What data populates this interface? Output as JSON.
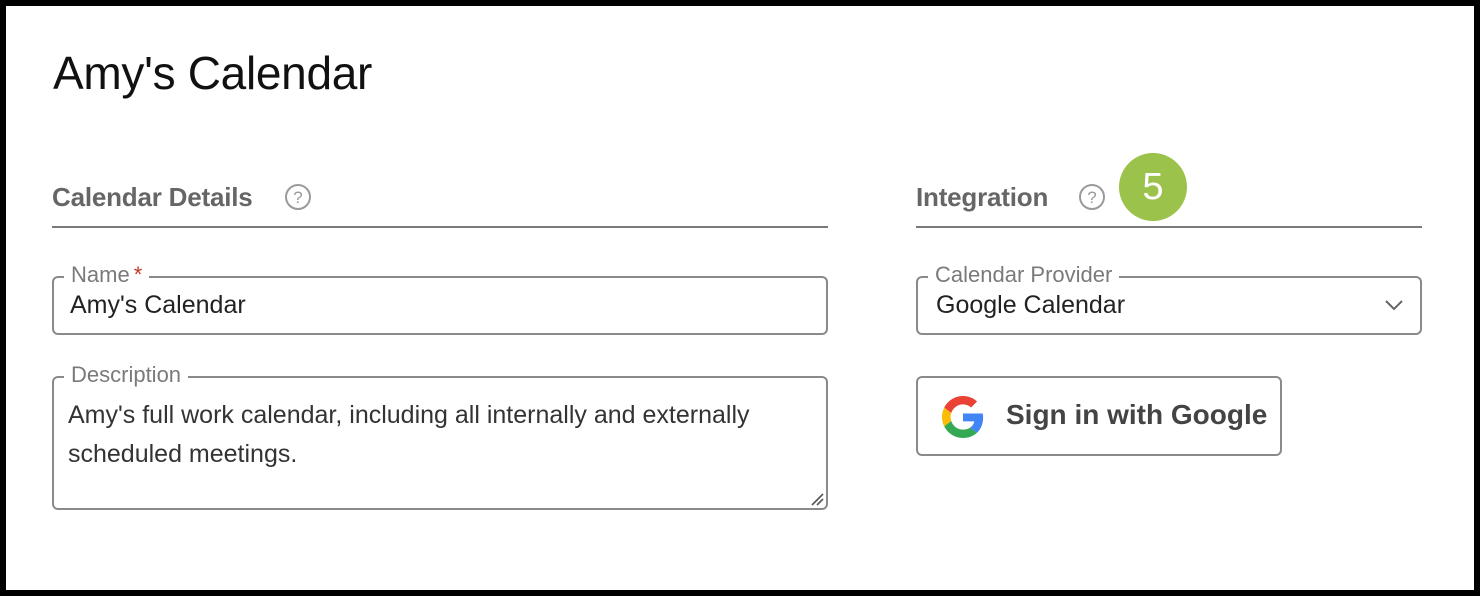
{
  "page": {
    "title": "Amy's Calendar"
  },
  "calendar_details": {
    "heading": "Calendar Details",
    "help_symbol": "?",
    "name_field": {
      "label": "Name",
      "required_marker": "*",
      "value": "Amy's Calendar"
    },
    "description_field": {
      "label": "Description",
      "value": "Amy's full work calendar, including all internally and externally scheduled meetings."
    }
  },
  "integration": {
    "heading": "Integration",
    "help_symbol": "?",
    "step_badge": "5",
    "provider_field": {
      "label": "Calendar Provider",
      "value": "Google Calendar"
    },
    "google_button": {
      "label": "Sign in with Google"
    }
  },
  "colors": {
    "badge": "#9bc24a",
    "required": "#c0392b",
    "border": "#8a8a8a",
    "heading": "#666666"
  },
  "icons": [
    "help-icon",
    "chevron-down-icon",
    "google-logo-icon",
    "resize-handle-icon"
  ]
}
